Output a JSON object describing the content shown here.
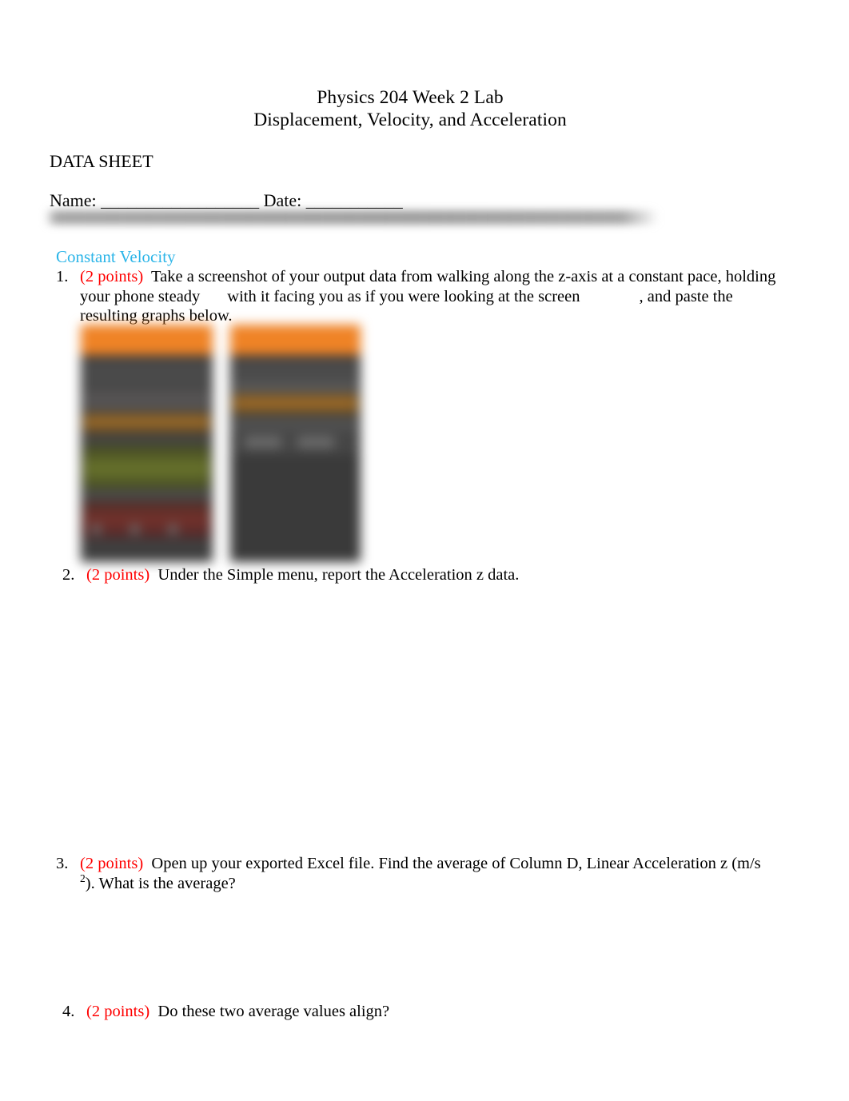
{
  "document": {
    "title_lines": [
      "Physics 204 Week 2 Lab",
      "Displacement, Velocity, and Acceleration"
    ],
    "datasheet_label": "DATA SHEET",
    "name_date_line": "Name: __________________ Date: ___________",
    "section_heading": "Constant Velocity",
    "points_label": "(2 points)",
    "items": [
      {
        "number": "1.",
        "points": "(2 points)",
        "text_part_1": "Take a screenshot of your output data from walking along the z-axis at a constant pace, holding your phone steady",
        "text_part_2": "with it facing you as if you were looking at the screen",
        "text_part_3": ", and paste the resulting graphs below."
      },
      {
        "number": "2.",
        "points": "(2 points)",
        "text": "Under the Simple menu, report the Acceleration z data."
      },
      {
        "number": "3.",
        "points": "(2 points)",
        "text_before_sup": "Open up your exported Excel file. Find the average of Column D, Linear Acceleration z (m/s ",
        "superscript": "2",
        "text_after_sup": "). What is the average?"
      },
      {
        "number": "4.",
        "points": "(2 points)",
        "text": "Do these two average values align?"
      }
    ],
    "screenshots": [
      {
        "caption": "blurred-phone-screenshot-graphs",
        "header_color": "#ef8326",
        "background_color": "#3b3b3b"
      },
      {
        "caption": "blurred-phone-screenshot-simple-menu",
        "header_color": "#ef8326",
        "background_color": "#3b3b3b"
      }
    ],
    "colors": {
      "heading_accent": "#2cb5e8",
      "points_color": "#ff0000",
      "text_color": "#000000",
      "redaction_gray": "#969696"
    }
  }
}
